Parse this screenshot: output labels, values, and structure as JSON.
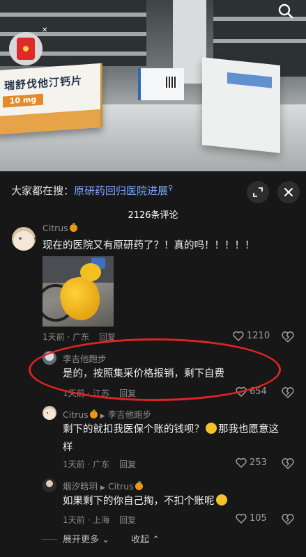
{
  "video": {
    "drug_box_label": "瑞舒伐他汀钙片",
    "drug_box_dose": "10 mg"
  },
  "hot_search": {
    "prefix": "大家都在搜：",
    "link": "原研药回归医院进展",
    "link_icon": "search-icon"
  },
  "comment_count": "2126条评论",
  "comments": [
    {
      "user": "Citrus",
      "badge": "orange-emoji",
      "text": "现在的医院又有原研药了？！真的吗！！！！！",
      "has_image": true,
      "time": "1天前",
      "location": "广东",
      "reply_label": "回复",
      "likes": "1210"
    },
    {
      "user": "李吉他跑步",
      "text": "是的，按照集采价格报销，剩下自费",
      "time": "1天前",
      "location": "江苏",
      "reply_label": "回复",
      "likes": "654",
      "highlighted": true
    },
    {
      "user": "Citrus",
      "reply_to": "李吉他跑步",
      "text_line1": "剩下的就扣我医保个账的钱呗？",
      "text_line1_tail": "那我也愿意这",
      "text_line2": "样",
      "time": "1天前",
      "location": "广东",
      "reply_label": "回复",
      "likes": "253"
    },
    {
      "user": "烟汐晗玥",
      "reply_to": "Citrus",
      "text": "如果剩下的你自己掏，不扣个账呢",
      "time": "1天前",
      "location": "上海",
      "reply_label": "回复",
      "likes": "105"
    }
  ],
  "footer": {
    "expand": "展开更多",
    "collapse": "收起"
  },
  "colors": {
    "panel_bg": "#171717",
    "link": "#7ca8ff",
    "highlight": "#e02424"
  }
}
